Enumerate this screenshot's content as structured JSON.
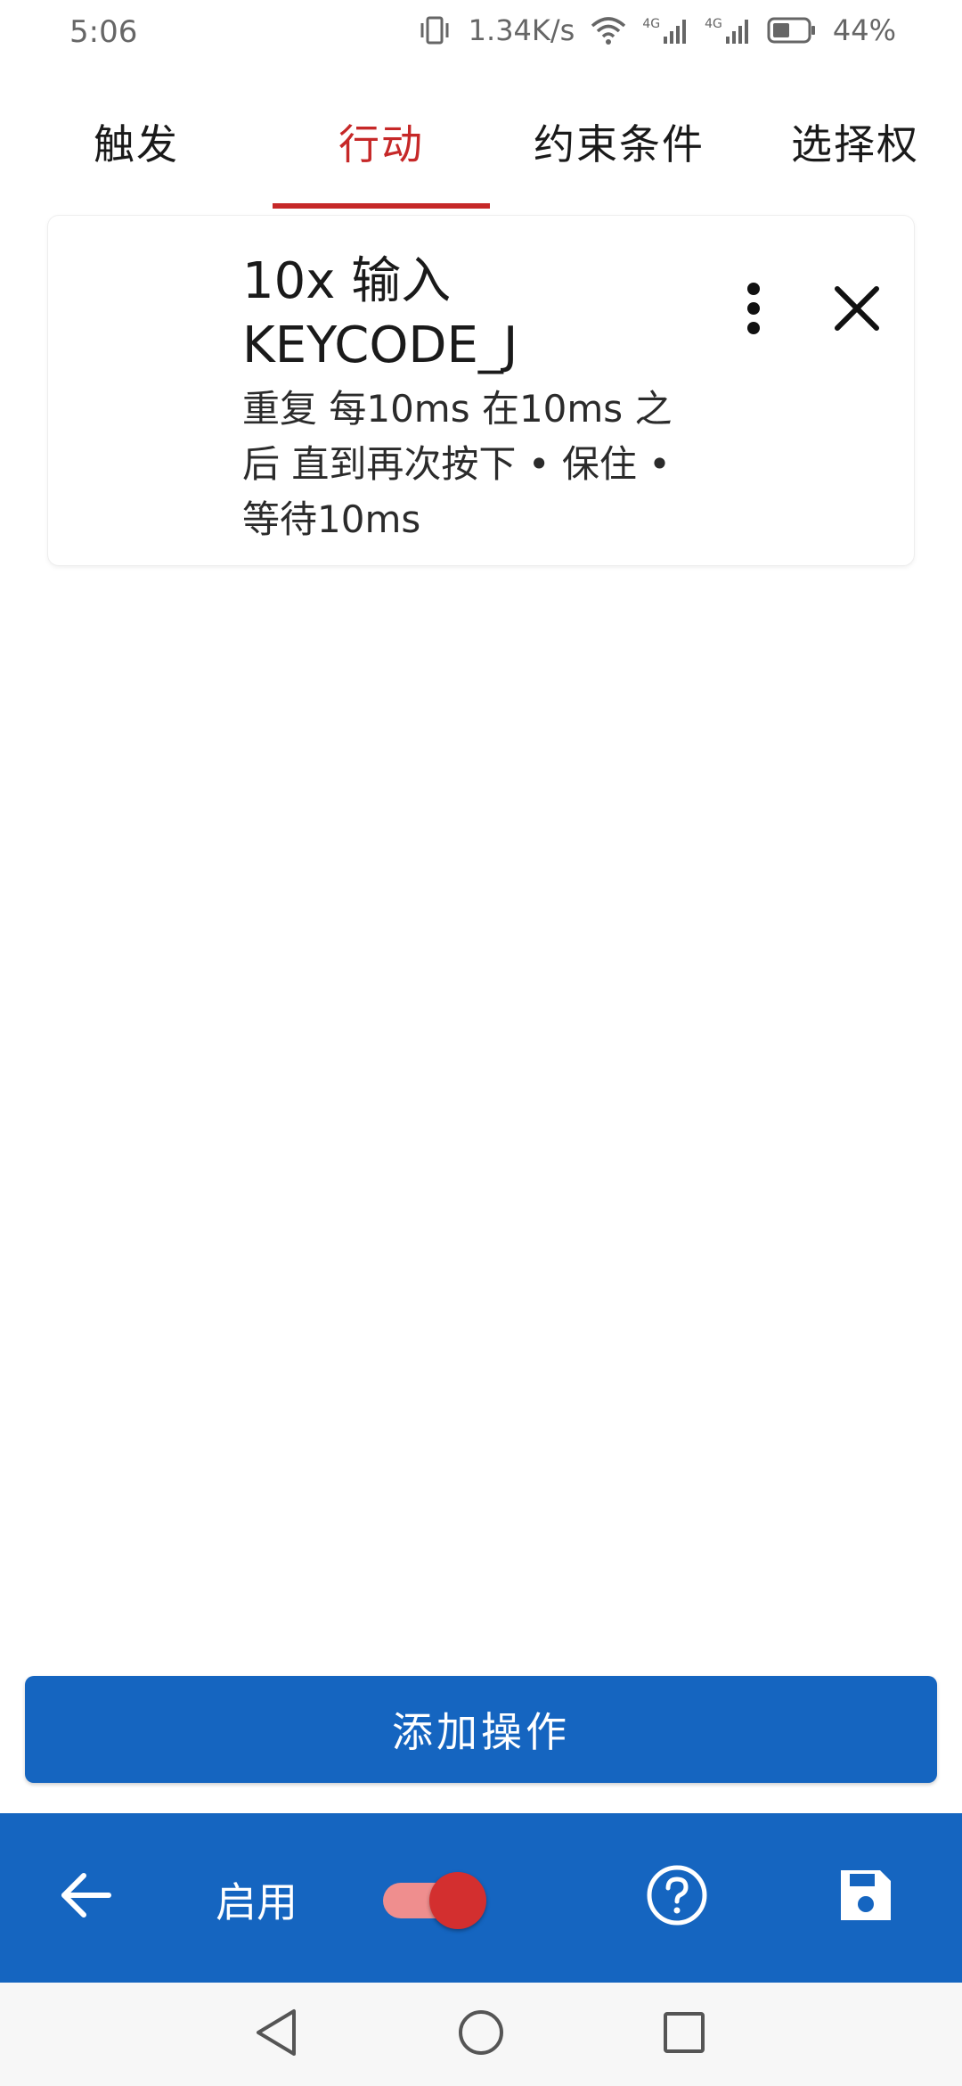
{
  "status_bar": {
    "time": "5:06",
    "speed": "1.34K/s",
    "network1": "4G",
    "network2": "4G",
    "battery": "44%"
  },
  "tabs": [
    {
      "label": "触发"
    },
    {
      "label": "行动"
    },
    {
      "label": "约束条件"
    },
    {
      "label": "选择权"
    }
  ],
  "action_card": {
    "title": "10x 输入 KEYCODE_J",
    "description": "重复 每10ms 在10ms 之后 直到再次按下 • 保住 • 等待10ms"
  },
  "add_button": {
    "label": "添加操作"
  },
  "bottom_bar": {
    "enable_label": "启用",
    "enabled": true
  },
  "colors": {
    "accent_red": "#c62828",
    "primary_blue": "#1565c0",
    "toggle_thumb": "#d32f2f",
    "toggle_track": "#ef8e8e"
  },
  "icons": {
    "back": "arrow-left-icon",
    "help": "help-circle-icon",
    "save": "floppy-disk-icon",
    "more": "more-vertical-icon",
    "close": "close-icon"
  }
}
